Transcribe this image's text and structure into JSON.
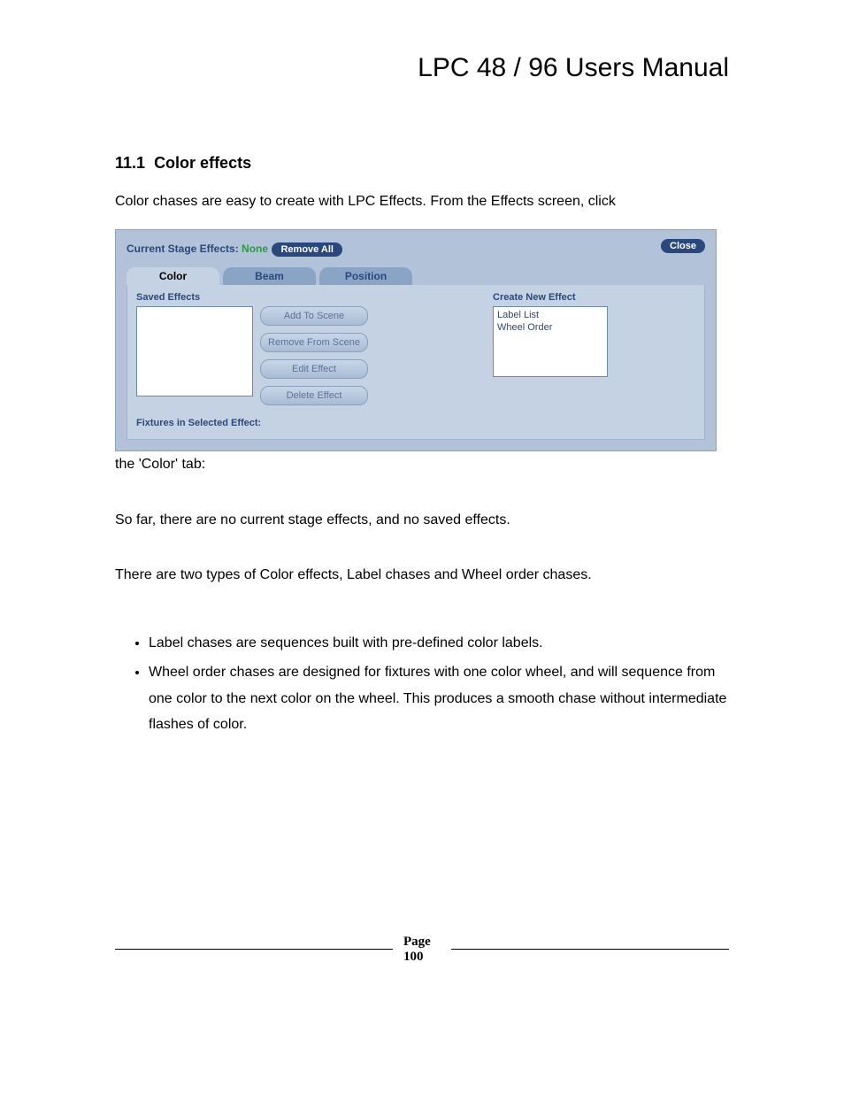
{
  "header": {
    "title": "LPC 48 / 96 Users Manual"
  },
  "section": {
    "number": "11.1",
    "heading": "Color effects",
    "intro": "Color chases are easy to create with LPC Effects.  From the Effects screen, click",
    "caption": "the 'Color' tab:",
    "p2": "So far, there are no current stage effects, and no saved effects.",
    "p3": "There are two types of Color effects, Label chases and Wheel order chases.",
    "bullets": [
      "Label chases are sequences built with pre-defined color labels.",
      "Wheel order chases are designed for fixtures with one color wheel, and will sequence from one color to the next color on the wheel.  This produces a smooth chase without intermediate flashes of color."
    ]
  },
  "screenshot": {
    "stage_label": "Current Stage Effects: ",
    "stage_value": "None",
    "remove_all": "Remove All",
    "close": "Close",
    "tabs": {
      "color": "Color",
      "beam": "Beam",
      "position": "Position"
    },
    "saved_effects": "Saved Effects",
    "buttons": {
      "add": "Add To Scene",
      "remove": "Remove From Scene",
      "edit": "Edit Effect",
      "delete": "Delete Effect"
    },
    "create_new": "Create New Effect",
    "effect_options": [
      "Label List",
      "Wheel Order"
    ],
    "fixtures": "Fixtures in Selected Effect:"
  },
  "footer": {
    "page_label": "Page",
    "page_number": "100"
  }
}
